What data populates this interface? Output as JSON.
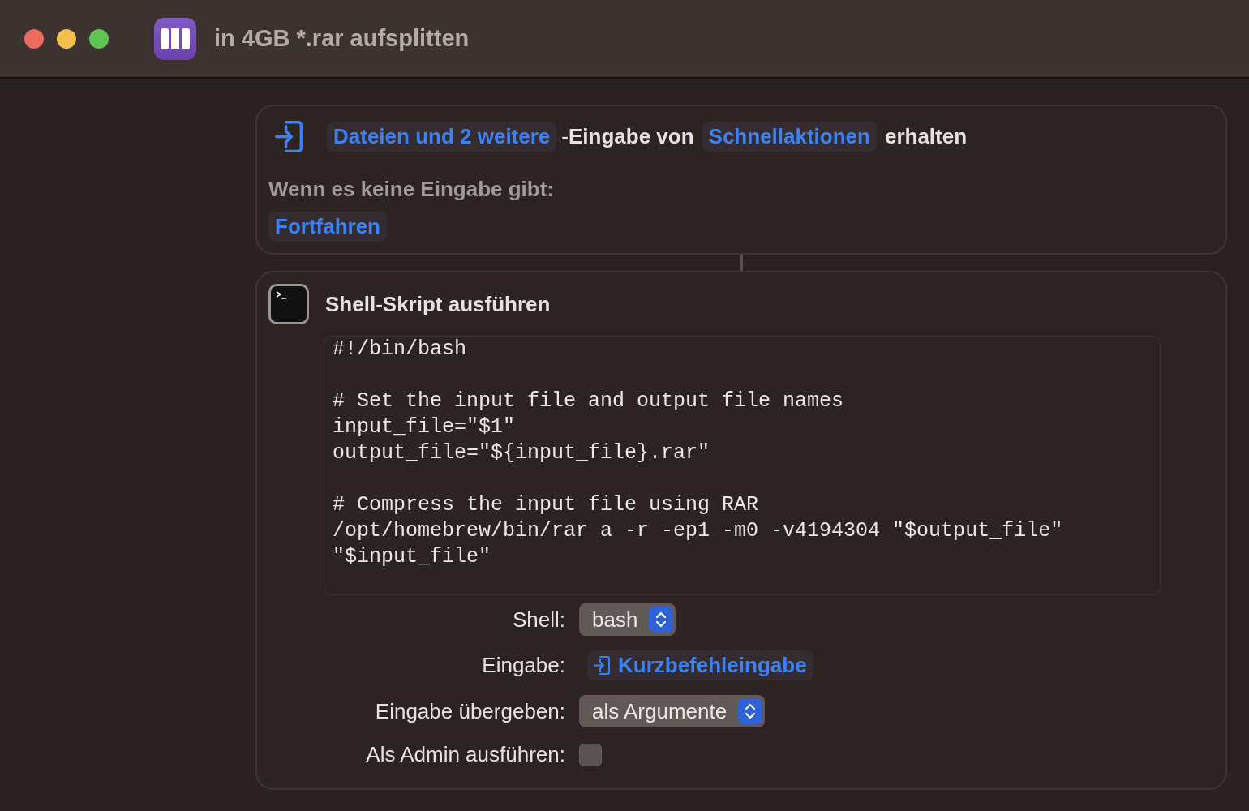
{
  "window": {
    "title": "in 4GB *.rar aufsplitten"
  },
  "receive_action": {
    "input_types": "Dateien und 2 weitere",
    "text_1": "-Eingabe von",
    "source": "Schnellaktionen",
    "text_2": "erhalten",
    "no_input_label": "Wenn es keine Eingabe gibt:",
    "no_input_action": "Fortfahren"
  },
  "shell_action": {
    "title": "Shell-Skript ausführen",
    "script_blocks": [
      [
        "#!/bin/bash"
      ],
      [
        "# Set the input file and output file names",
        "input_file=\"$1\"",
        "output_file=\"${input_file}.rar\""
      ],
      [
        "# Compress the input file using RAR",
        "/opt/homebrew/bin/rar a -r -ep1 -m0 -v4194304 \"$output_file\"",
        "\"$input_file\""
      ]
    ],
    "options": [
      {
        "kind": "popup",
        "label": "Shell:",
        "value": "bash"
      },
      {
        "kind": "token",
        "label": "Eingabe:",
        "value": "Kurzbefehleingabe"
      },
      {
        "kind": "popup",
        "label": "Eingabe übergeben:",
        "value": "als Argumente"
      },
      {
        "kind": "checkbox",
        "label": "Als Admin ausführen:",
        "checked": false
      }
    ]
  }
}
